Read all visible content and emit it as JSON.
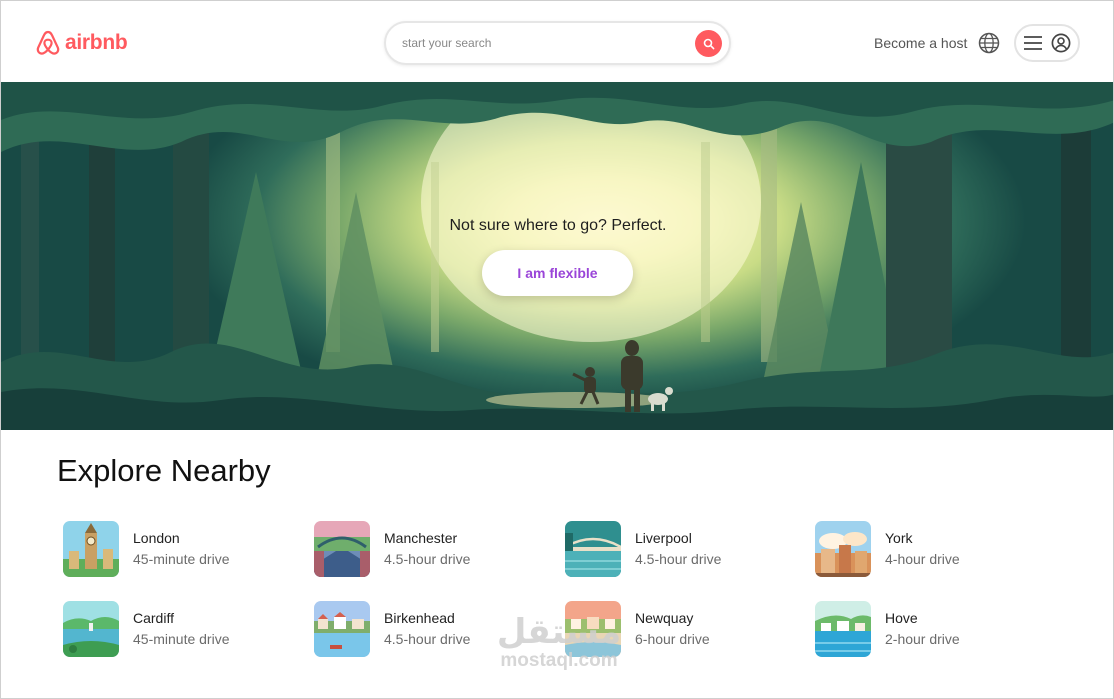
{
  "header": {
    "logo_text": "airbnb",
    "search_placeholder": "start your search",
    "host_link": "Become a host"
  },
  "hero": {
    "tagline": "Not sure where to go? Perfect.",
    "button_label": "I am flexible"
  },
  "explore": {
    "title": "Explore Nearby",
    "items": [
      {
        "city": "London",
        "drive": "45-minute drive"
      },
      {
        "city": "Manchester",
        "drive": "4.5-hour drive"
      },
      {
        "city": "Liverpool",
        "drive": "4.5-hour drive"
      },
      {
        "city": "York",
        "drive": "4-hour drive"
      },
      {
        "city": "Cardiff",
        "drive": "45-minute drive"
      },
      {
        "city": "Birkenhead",
        "drive": "4.5-hour drive"
      },
      {
        "city": "Newquay",
        "drive": "6-hour drive"
      },
      {
        "city": "Hove",
        "drive": "2-hour drive"
      }
    ]
  },
  "watermark": {
    "top": "مستقل",
    "bottom": "mostaql.com"
  },
  "colors": {
    "brand": "#ff5a5f",
    "flexible_button_text": "#9a45d8"
  },
  "icons": {
    "logo": "airbnb-logo-icon",
    "search": "search-icon",
    "globe": "globe-icon",
    "menu": "hamburger-menu-icon",
    "user": "user-avatar-icon"
  }
}
